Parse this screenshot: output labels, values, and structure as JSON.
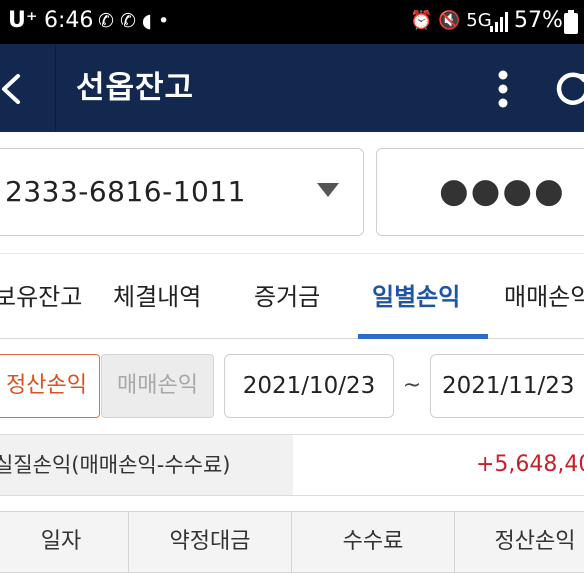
{
  "status_bar": {
    "carrier": "U⁺",
    "time": "6:46",
    "notif_icons": "✆ ✆ ◖ •",
    "sys_icons": "⏰ 🔇 5G",
    "battery": "57%"
  },
  "header": {
    "title": "선옵잔고"
  },
  "account": {
    "number": "2333-6816-1011",
    "password_mask": "●●●●"
  },
  "tabs": [
    {
      "label": "보유잔고",
      "active": false
    },
    {
      "label": "체결내역",
      "active": false
    },
    {
      "label": "증거금",
      "active": false
    },
    {
      "label": "일별손익",
      "active": true
    },
    {
      "label": "매매손익",
      "active": false
    }
  ],
  "filters": {
    "settle_label": "정산손익",
    "trade_label": "매매손익",
    "date_from": "2021/10/23",
    "separator": "~",
    "date_to": "2021/11/23"
  },
  "summary": {
    "label": "실질손익(매매손익-수수료)",
    "value": "+5,648,40"
  },
  "table": {
    "headers": [
      "일자",
      "약정대금",
      "수수료",
      "정산손익"
    ]
  },
  "colors": {
    "header_bg": "#13284e",
    "active_tab": "#1f55a5",
    "accent_orange": "#d9531e",
    "profit_red": "#c8202b"
  }
}
